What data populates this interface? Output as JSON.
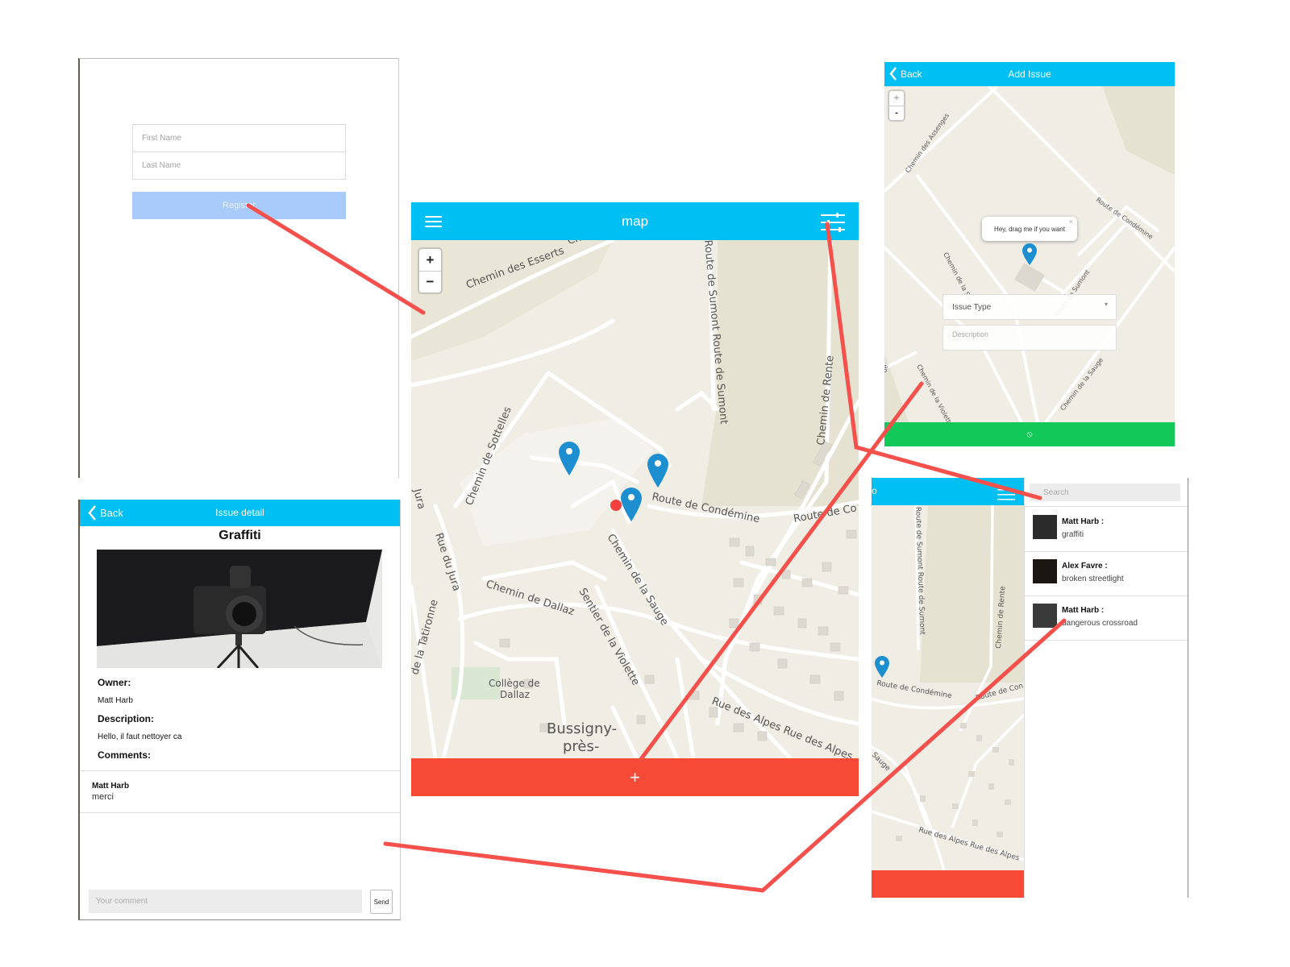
{
  "register": {
    "first_name_placeholder": "First Name",
    "last_name_placeholder": "Last Name",
    "register_label": "Register"
  },
  "map_screen": {
    "title": "map",
    "zoom_in": "+",
    "zoom_out": "−",
    "add_label": "+",
    "map_labels": {
      "chemin_des_esserts": "Chemin des Esserts",
      "chem": "Chem",
      "route_sumont": "Route de Sumont Route de Sumont",
      "chemin_de_rente": "Chemin de Rente",
      "chemin_de_sottelles": "Chemin de Sottelles",
      "route_condemine": "Route de Condémine",
      "route_co": "Route de Co",
      "jura": "Jura",
      "rue_du_jura": "Rue du Jura",
      "chemin_de_dallaz": "Chemin de Dallaz",
      "chemin_de_la_sauge": "Chemin de la Sauge",
      "sentier_violette": "Sentier de la Violette",
      "de_la_tatironne": "de la Tatironne",
      "college": "Collège de",
      "dallaz": "Dallaz",
      "rue_des_alpes": "Rue des Alpes Rue des Alpes",
      "bussigny": "Bussigny-",
      "pres": "près-"
    }
  },
  "add_issue": {
    "back_label": "Back",
    "title": "Add Issue",
    "zoom_in": "+",
    "zoom_out": "-",
    "tooltip": "Hey, drag me if you want",
    "tooltip_close": "×",
    "issue_type_placeholder": "Issue Type",
    "description_placeholder": "Description",
    "submit_icon": "⦸",
    "map_labels": {
      "assenges": "Chemin des Assenges",
      "condemine": "Route de Condémine",
      "chemin_de_la_sauge": "Chemin de la Sauge",
      "route_de_sumont": "Route de Sumont",
      "chemin_de_la_violette": "Chemin de la Violette",
      "chemin_de_la_sauge_2": "Chemin de la Sauge",
      "ue": "ue"
    }
  },
  "issue_detail": {
    "back_label": "Back",
    "title": "Issue detail",
    "issue_title": "Graffiti",
    "owner_label": "Owner:",
    "owner_value": "Matt Harb",
    "description_label": "Description:",
    "description_value": "Hello, il faut nettoyer ca",
    "comments_label": "Comments:",
    "comments": [
      {
        "author": "Matt Harb",
        "text": "merci"
      }
    ],
    "comment_placeholder": "Your comment",
    "send_label": "Send"
  },
  "issue_list": {
    "search_placeholder": "Search",
    "header_fragment": "o",
    "items": [
      {
        "author": "Matt Harb :",
        "text": "graffiti"
      },
      {
        "author": "Alex Favre :",
        "text": "broken streetlight"
      },
      {
        "author": "Matt Harb :",
        "text": "dangerous crossroad"
      }
    ],
    "map_labels": {
      "route_sumont": "Route de Sumont Route de Sumont",
      "chemin_de_rente": "Chemin de Rente",
      "route_condemine": "Route de Condémine",
      "route_de_con": "Route de Con",
      "sauge": "Sauge",
      "rue_des_alpes": "Rue des Alpes Rue des Alpes"
    }
  },
  "colors": {
    "header": "#00bff3",
    "add_bar": "#f44a36",
    "register_button": "#a9cbfc",
    "submit_bar": "#12c858",
    "connector": "#f5504b",
    "marker": "#1d8fd1",
    "location_dot": "#f04040"
  },
  "icons": {
    "menu": "hamburger-icon",
    "filter": "sliders-icon",
    "back": "chevron-left-icon",
    "marker": "map-marker-icon",
    "add": "plus-icon"
  }
}
